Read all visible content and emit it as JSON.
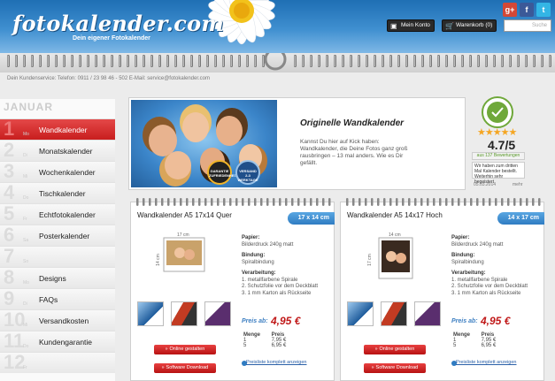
{
  "header": {
    "logo": "fotokalender.com",
    "tagline": "Dein eigener Fotokalender",
    "social": [
      {
        "name": "google-plus",
        "label": "g+",
        "color": "#d34836"
      },
      {
        "name": "facebook",
        "label": "f",
        "color": "#3b5998"
      },
      {
        "name": "twitter",
        "label": "t",
        "color": "#33b5e5"
      }
    ],
    "account_label": "Mein Konto",
    "cart_label": "Warenkorb (0)",
    "search_placeholder": "Suche"
  },
  "service_line": "Dein Kundenservice: Telefon: 0911 / 23 98 46 - 502 E-Mail: service@fotokalender.com",
  "sidebar": {
    "month": "JANUAR",
    "items": [
      {
        "num": "1",
        "abbr": "Mo",
        "label": "Wandkalender",
        "active": true
      },
      {
        "num": "2",
        "abbr": "Di",
        "label": "Monatskalender",
        "active": false
      },
      {
        "num": "3",
        "abbr": "Mi",
        "label": "Wochenkalender",
        "active": false
      },
      {
        "num": "4",
        "abbr": "Do",
        "label": "Tischkalender",
        "active": false
      },
      {
        "num": "5",
        "abbr": "Fr",
        "label": "Echtfotokalender",
        "active": false
      },
      {
        "num": "6",
        "abbr": "Sa",
        "label": "Posterkalender",
        "active": false
      },
      {
        "num": "7",
        "abbr": "So",
        "label": "",
        "active": false
      },
      {
        "num": "8",
        "abbr": "Mo",
        "label": "Designs",
        "active": false
      },
      {
        "num": "9",
        "abbr": "Di",
        "label": "FAQs",
        "active": false
      },
      {
        "num": "10",
        "abbr": "Mi",
        "label": "Versandkosten",
        "active": false
      },
      {
        "num": "11",
        "abbr": "Do",
        "label": "Kundengarantie",
        "active": false
      },
      {
        "num": "12",
        "abbr": "Fr",
        "label": "",
        "active": false
      }
    ]
  },
  "banner": {
    "title": "Originelle Wandkalender",
    "text": "Kannst Du hier auf Kick haben: Wandkalender, die Deine Fotos ganz groß rausbringen – 13 mal anders. Wie es Dir gefällt.",
    "badge1": "GARANTIE ZUFRIEDENHEIT",
    "badge2": "VERSAND 2-3 WERKTAGE"
  },
  "rating": {
    "seal": "KUNDEN MEINUNG",
    "seal_note": "geprüft",
    "stars": "★★★★★",
    "score": "4.7/5",
    "reviews": "aus 137 Bewertungen",
    "quote": "Wir haben zum dritten Mal Kalender bestellt. Weiterhin sehr begeistert",
    "date": "05.03.2014",
    "more": "mehr"
  },
  "products": [
    {
      "title": "Wandkalender A5 17x14 Quer",
      "size_tab": "17 x 14 cm",
      "dim_w": "17 cm",
      "dim_h": "14 cm",
      "papier_k": "Papier:",
      "papier_v": "Bilderdruck 240g matt",
      "bindung_k": "Bindung:",
      "bindung_v": "Spiralbindung",
      "verarbeitung_k": "Verarbeitung:",
      "verarbeitung": [
        "1. metallfarbene Spirale",
        "2. Schutzfolie vor dem Deckblatt",
        "3. 1 mm Karton als Rückseite"
      ],
      "price_label": "Preis ab:",
      "price": "4,95 €",
      "table_head": [
        "Menge",
        "Preis"
      ],
      "table_rows": [
        [
          "1",
          "7,95 €"
        ],
        [
          "5",
          "6,95 €"
        ]
      ],
      "btn_design": "Online gestalten",
      "btn_software": "Software Download",
      "link": "Preisliste komplett anzeigen"
    },
    {
      "title": "Wandkalender A5 14x17 Hoch",
      "size_tab": "14 x 17 cm",
      "dim_w": "14 cm",
      "dim_h": "17 cm",
      "papier_k": "Papier:",
      "papier_v": "Bilderdruck 240g matt",
      "bindung_k": "Bindung:",
      "bindung_v": "Spiralbindung",
      "verarbeitung_k": "Verarbeitung:",
      "verarbeitung": [
        "1. metallfarbene Spirale",
        "2. Schutzfolie vor dem Deckblatt",
        "3. 1 mm Karton als Rückseite"
      ],
      "price_label": "Preis ab:",
      "price": "4,95 €",
      "table_head": [
        "Menge",
        "Preis"
      ],
      "table_rows": [
        [
          "1",
          "7,95 €"
        ],
        [
          "5",
          "6,95 €"
        ]
      ],
      "btn_design": "Online gestalten",
      "btn_software": "Software Download",
      "link": "Preisliste komplett anzeigen"
    }
  ],
  "colors": {
    "accent_blue": "#2f7cc2",
    "nav_red": "#c81e1e",
    "price_red": "#c01818"
  }
}
